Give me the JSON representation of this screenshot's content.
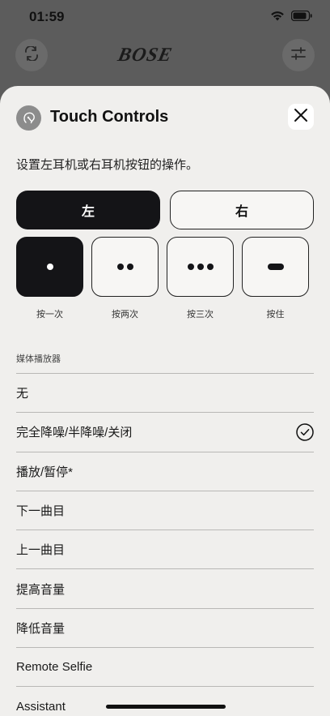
{
  "status_bar": {
    "time": "01:59"
  },
  "background_header": {
    "logo_text": "BOSE"
  },
  "sheet": {
    "title": "Touch Controls",
    "description": "设置左耳机或右耳机按钮的操作。"
  },
  "earbud_tabs": [
    {
      "label": "左",
      "selected": true
    },
    {
      "label": "右",
      "selected": false
    }
  ],
  "gestures": [
    {
      "label": "按一次",
      "icon": "single-dot-icon",
      "selected": true
    },
    {
      "label": "按两次",
      "icon": "double-dot-icon",
      "selected": false
    },
    {
      "label": "按三次",
      "icon": "triple-dot-icon",
      "selected": false
    },
    {
      "label": "按住",
      "icon": "hold-dash-icon",
      "selected": false
    }
  ],
  "section": {
    "label": "媒体播放器"
  },
  "options": [
    {
      "label": "无",
      "checked": false
    },
    {
      "label": "完全降噪/半降噪/关闭",
      "checked": true
    },
    {
      "label": "播放/暂停*",
      "checked": false
    },
    {
      "label": "下一曲目",
      "checked": false
    },
    {
      "label": "上一曲目",
      "checked": false
    },
    {
      "label": "提高音量",
      "checked": false
    },
    {
      "label": "降低音量",
      "checked": false
    },
    {
      "label": "Remote Selfie",
      "checked": false
    },
    {
      "label": "Assistant",
      "checked": false
    }
  ],
  "colors": {
    "sheet_bg": "#f0efed",
    "selected_bg": "#141417",
    "backdrop": "#5c5c5c"
  }
}
